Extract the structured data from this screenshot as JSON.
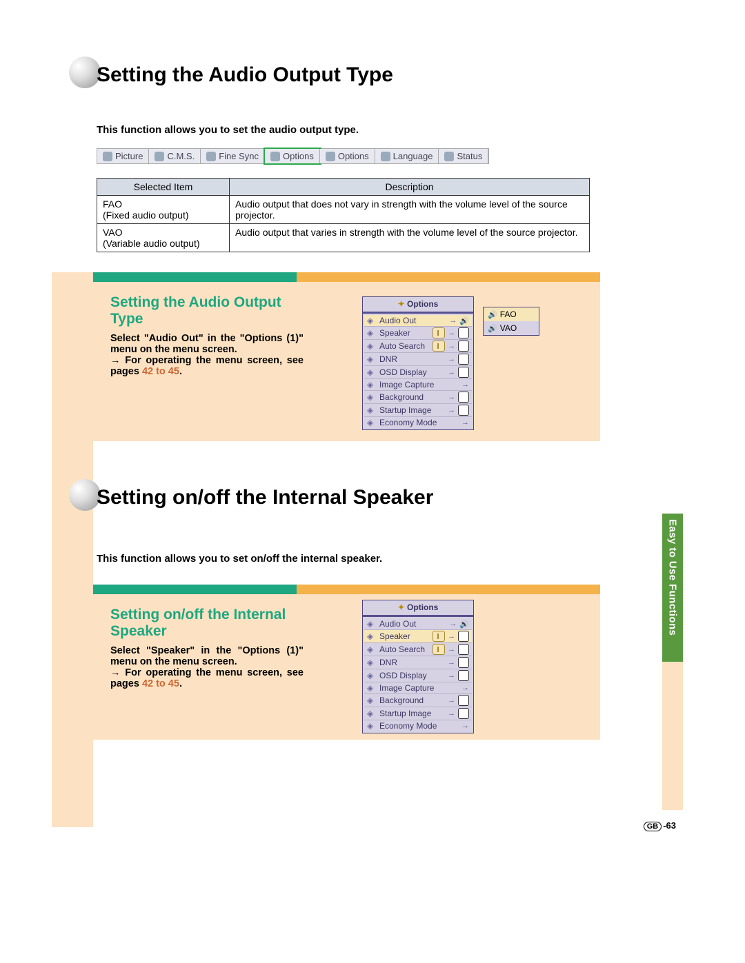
{
  "headings": {
    "h1": "Setting the Audio Output Type",
    "h2": "Setting on/off the Internal Speaker"
  },
  "intros": {
    "a": "This function allows you to set the audio output type.",
    "b": "This function allows you to set on/off the internal speaker."
  },
  "menubar": {
    "tabs": [
      "Picture",
      "C.M.S.",
      "Fine Sync",
      "Options",
      "Options",
      "Language",
      "Status"
    ],
    "selected_index": 3
  },
  "table": {
    "head": {
      "c1": "Selected Item",
      "c2": "Description"
    },
    "rows": [
      {
        "c1a": "FAO",
        "c1b": "(Fixed audio output)",
        "c2": "Audio output that does not vary in strength with the volume level of the source projector."
      },
      {
        "c1a": "VAO",
        "c1b": "(Variable audio output)",
        "c2": "Audio output that varies in strength with the volume level of the source projector."
      }
    ]
  },
  "section1": {
    "title": "Setting the Audio Output Type",
    "body1": "Select \"Audio Out\" in the \"Options (1)\" menu on the menu screen.",
    "body2": "→ For operating the menu screen, see pages ",
    "link": "42 to 45",
    "dot": "."
  },
  "section2": {
    "title": "Setting on/off the Internal Speaker",
    "body1": "Select \"Speaker\" in the \"Options (1)\" menu on the menu screen.",
    "body2": "→ For operating the menu screen, see pages ",
    "link": "42 to 45",
    "dot": "."
  },
  "panel": {
    "title": "Options",
    "rows": [
      {
        "label": "Audio Out",
        "suffix": "→🔊"
      },
      {
        "label": "Speaker",
        "suffix": "→"
      },
      {
        "label": "Auto Search",
        "suffix": "→"
      },
      {
        "label": "DNR",
        "suffix": "→"
      },
      {
        "label": "OSD Display",
        "suffix": "→"
      },
      {
        "label": "Image Capture",
        "suffix": "→"
      },
      {
        "label": "Background",
        "suffix": "→"
      },
      {
        "label": "Startup Image",
        "suffix": "→"
      },
      {
        "label": "Economy Mode",
        "suffix": "→"
      }
    ],
    "side": [
      {
        "label": "FAO"
      },
      {
        "label": "VAO"
      }
    ],
    "highlight1": 0,
    "highlight2": 1
  },
  "side_tab": "Easy to Use Functions",
  "page_num": {
    "prefix": "GB",
    "num": "-63"
  }
}
